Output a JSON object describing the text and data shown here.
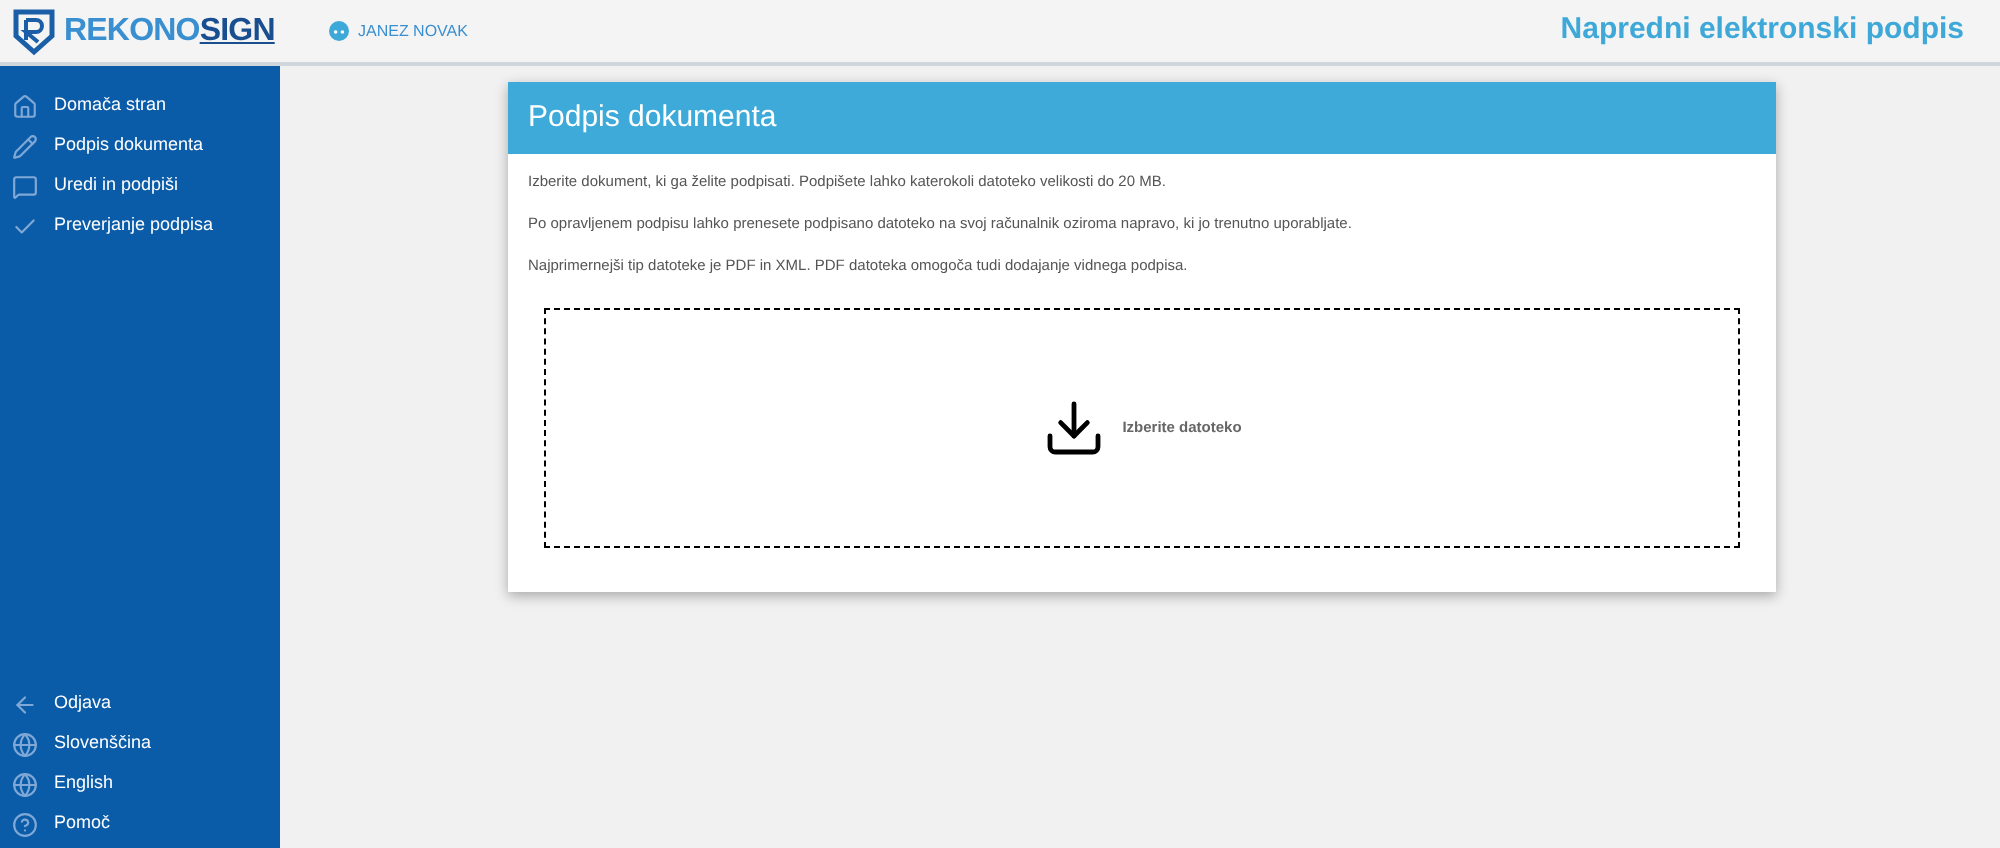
{
  "logo": {
    "part1": "REKONO",
    "part2": "SIGN"
  },
  "user": {
    "name": "JANEZ NOVAK"
  },
  "app_title": "Napredni elektronski podpis",
  "sidebar": {
    "items": [
      {
        "kind": "home",
        "label": "Domača stran"
      },
      {
        "kind": "pen",
        "label": "Podpis dokumenta"
      },
      {
        "kind": "note",
        "label": "Uredi in podpiši"
      },
      {
        "kind": "check",
        "label": "Preverjanje podpisa"
      }
    ],
    "bottom_items": [
      {
        "kind": "back",
        "label": "Odjava"
      },
      {
        "kind": "globe",
        "label": "Slovenščina"
      },
      {
        "kind": "globe",
        "label": "English"
      },
      {
        "kind": "help",
        "label": "Pomoč"
      }
    ]
  },
  "card": {
    "title": "Podpis dokumenta",
    "paragraphs": [
      "Izberite dokument, ki ga želite podpisati. Podpišete lahko katerokoli datoteko velikosti do 20 MB.",
      "Po opravljenem podpisu lahko prenesete podpisano datoteko na svoj računalnik oziroma napravo, ki jo trenutno uporabljate.",
      "Najprimernejši tip datoteke je PDF in XML. PDF datoteka omogoča tudi dodajanje vidnega podpisa."
    ],
    "dropzone": {
      "label": "Izberite datoteko"
    }
  }
}
